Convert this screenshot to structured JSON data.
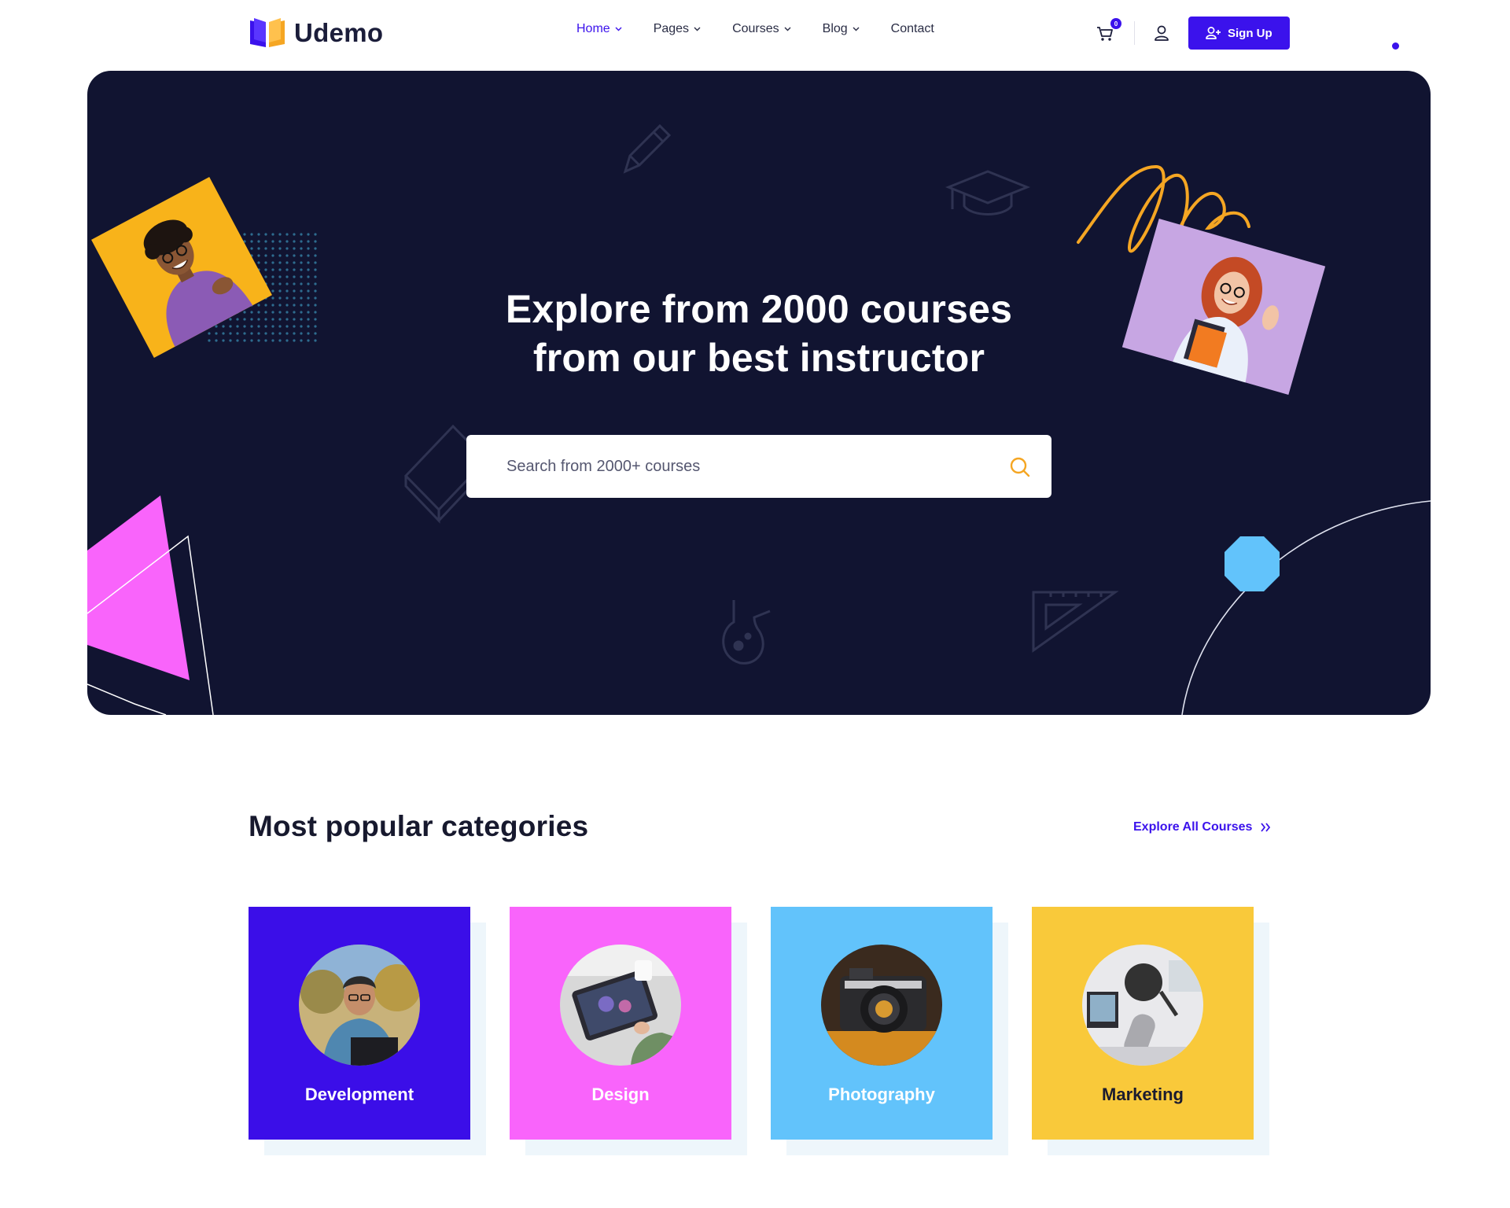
{
  "brand": {
    "name": "Udemo"
  },
  "nav": {
    "items": [
      {
        "label": "Home",
        "dropdown": true,
        "active": true
      },
      {
        "label": "Pages",
        "dropdown": true,
        "active": false
      },
      {
        "label": "Courses",
        "dropdown": true,
        "active": false
      },
      {
        "label": "Blog",
        "dropdown": true,
        "active": false
      },
      {
        "label": "Contact",
        "dropdown": false,
        "active": false
      }
    ]
  },
  "header": {
    "cart_count": "0",
    "signup_label": "Sign Up"
  },
  "hero": {
    "title_line1": "Explore from 2000 courses",
    "title_line2": "from our best instructor",
    "search_placeholder": "Search from 2000+ courses"
  },
  "categories": {
    "title_prefix": "Most popular",
    "title_highlight": "categories",
    "explore_label": "Explore All Courses",
    "items": [
      {
        "label": "Development",
        "color": "#3b0ee8",
        "label_color": "#ffffff"
      },
      {
        "label": "Design",
        "color": "#f964fb",
        "label_color": "#ffffff"
      },
      {
        "label": "Photography",
        "color": "#62c3fb",
        "label_color": "#ffffff"
      },
      {
        "label": "Marketing",
        "color": "#f9c93a",
        "label_color": "#1b1b2f"
      }
    ]
  },
  "colors": {
    "accent": "#3b12ec",
    "hero_bg": "#111431",
    "orange": "#f5a623"
  }
}
